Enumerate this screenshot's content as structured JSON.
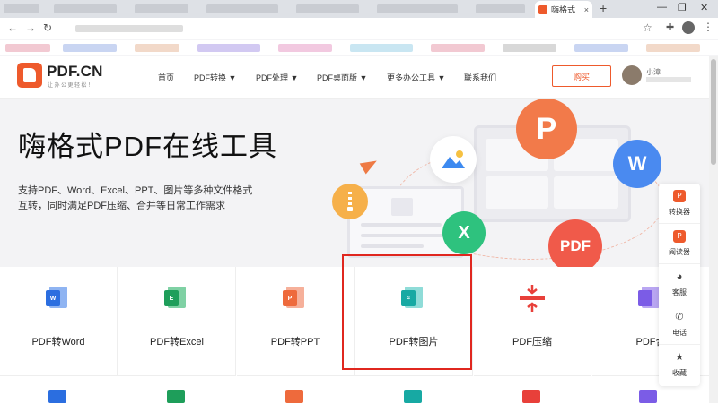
{
  "browser": {
    "tab_title": "嗨格式",
    "tab_close": "×",
    "new_tab": "+",
    "window_controls": [
      "—",
      "❐",
      "✕"
    ],
    "nav": [
      "←",
      "→",
      "↻"
    ],
    "icons": [
      "star-icon",
      "extension-icon",
      "profile-icon",
      "menu-icon"
    ]
  },
  "header": {
    "logo_text": "PDF.CN",
    "logo_sub": "让办公更轻松！",
    "nav_items": [
      "首页",
      "PDF转换 ▼",
      "PDF处理 ▼",
      "PDF桌面版 ▼",
      "更多办公工具 ▼",
      "联系我们"
    ],
    "buy_label": "购买",
    "user_name": "小漳"
  },
  "hero": {
    "title": "嗨格式PDF在线工具",
    "desc_line1": "支持PDF、Word、Excel、PPT、图片等多种文件格式",
    "desc_line2": "互转，同时满足PDF压缩、合并等日常工作需求",
    "bubbles": {
      "p": "P",
      "w": "W",
      "x": "X",
      "pdf": "PDF"
    }
  },
  "tools": [
    {
      "label": "PDF转Word",
      "icon": "word-icon",
      "glyph": "W",
      "color": "#2b6ee0"
    },
    {
      "label": "PDF转Excel",
      "icon": "excel-icon",
      "glyph": "E",
      "color": "#1e9e5a"
    },
    {
      "label": "PDF转PPT",
      "icon": "ppt-icon",
      "glyph": "P",
      "color": "#ee6a3c"
    },
    {
      "label": "PDF转图片",
      "icon": "image-icon",
      "glyph": "≈",
      "color": "#17a9a3"
    },
    {
      "label": "PDF压缩",
      "icon": "compress-icon",
      "glyph": "",
      "color": "#e8403a"
    },
    {
      "label": "PDF合",
      "icon": "merge-icon",
      "glyph": "",
      "color": "#7b5ce6"
    }
  ],
  "float_panel": [
    {
      "label": "转换器",
      "icon": "converter-icon",
      "glyph": "P"
    },
    {
      "label": "阅读器",
      "icon": "reader-icon",
      "glyph": "P"
    },
    {
      "label": "客服",
      "icon": "support-icon",
      "glyph": "◕"
    },
    {
      "label": "电话",
      "icon": "phone-icon",
      "glyph": "✆"
    },
    {
      "label": "收藏",
      "icon": "favorite-icon",
      "glyph": "★"
    }
  ],
  "colors": {
    "brand": "#ee5a2c",
    "highlight": "#e0271f"
  }
}
